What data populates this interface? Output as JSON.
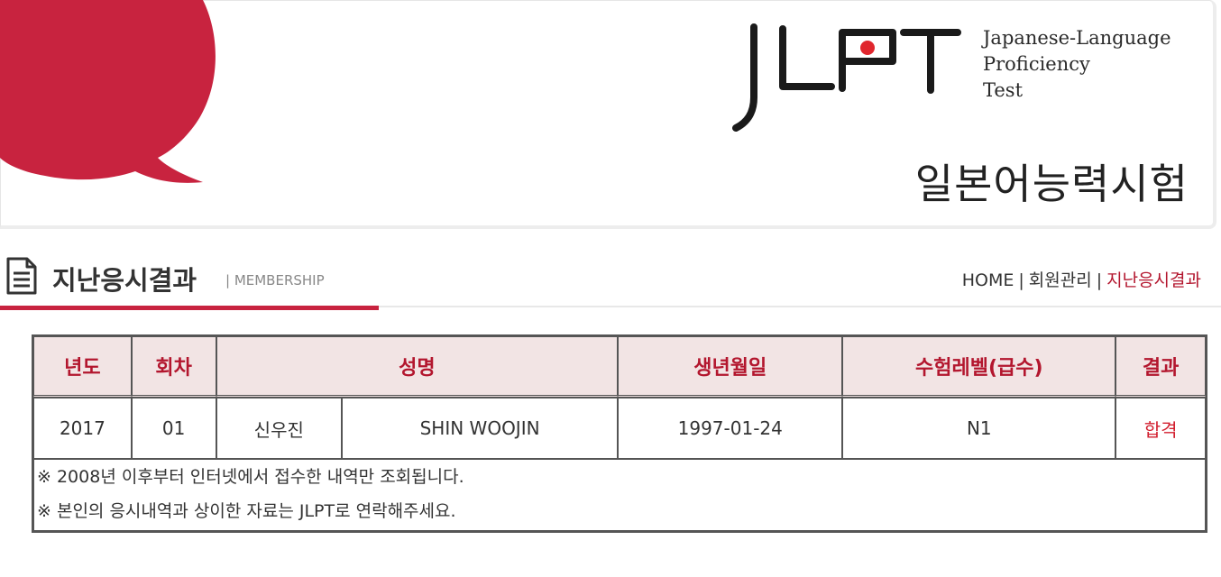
{
  "banner": {
    "logo_text": "JLPT",
    "logo_sub": [
      "Japanese-Language",
      "Proficiency",
      "Test"
    ],
    "korean_title": "일본어능력시험",
    "accent_color": "#c8233f"
  },
  "page": {
    "title": "지난응시결과",
    "subtitle": "| MEMBERSHIP",
    "title_icon": "document-icon"
  },
  "breadcrumb": {
    "items": [
      "HOME",
      "회원관리",
      "지난응시결과"
    ],
    "separator": "|"
  },
  "table": {
    "headers": [
      "년도",
      "회차",
      "성명",
      "생년월일",
      "수험레벨(급수)",
      "결과"
    ],
    "rows": [
      {
        "year": "2017",
        "round": "01",
        "name_kr": "신우진",
        "name_en": "SHIN WOOJIN",
        "birth": "1997-01-24",
        "level": "N1",
        "result": "합격"
      }
    ],
    "notes": [
      "※ 2008년 이후부터 인터넷에서 접수한 내역만 조회됩니다.",
      "※ 본인의 응시내역과 상이한 자료는 JLPT로 연락해주세요."
    ]
  },
  "colors": {
    "header_bg": "#f2e4e4",
    "header_text": "#b3162e",
    "pass_text": "#d21f2f"
  }
}
